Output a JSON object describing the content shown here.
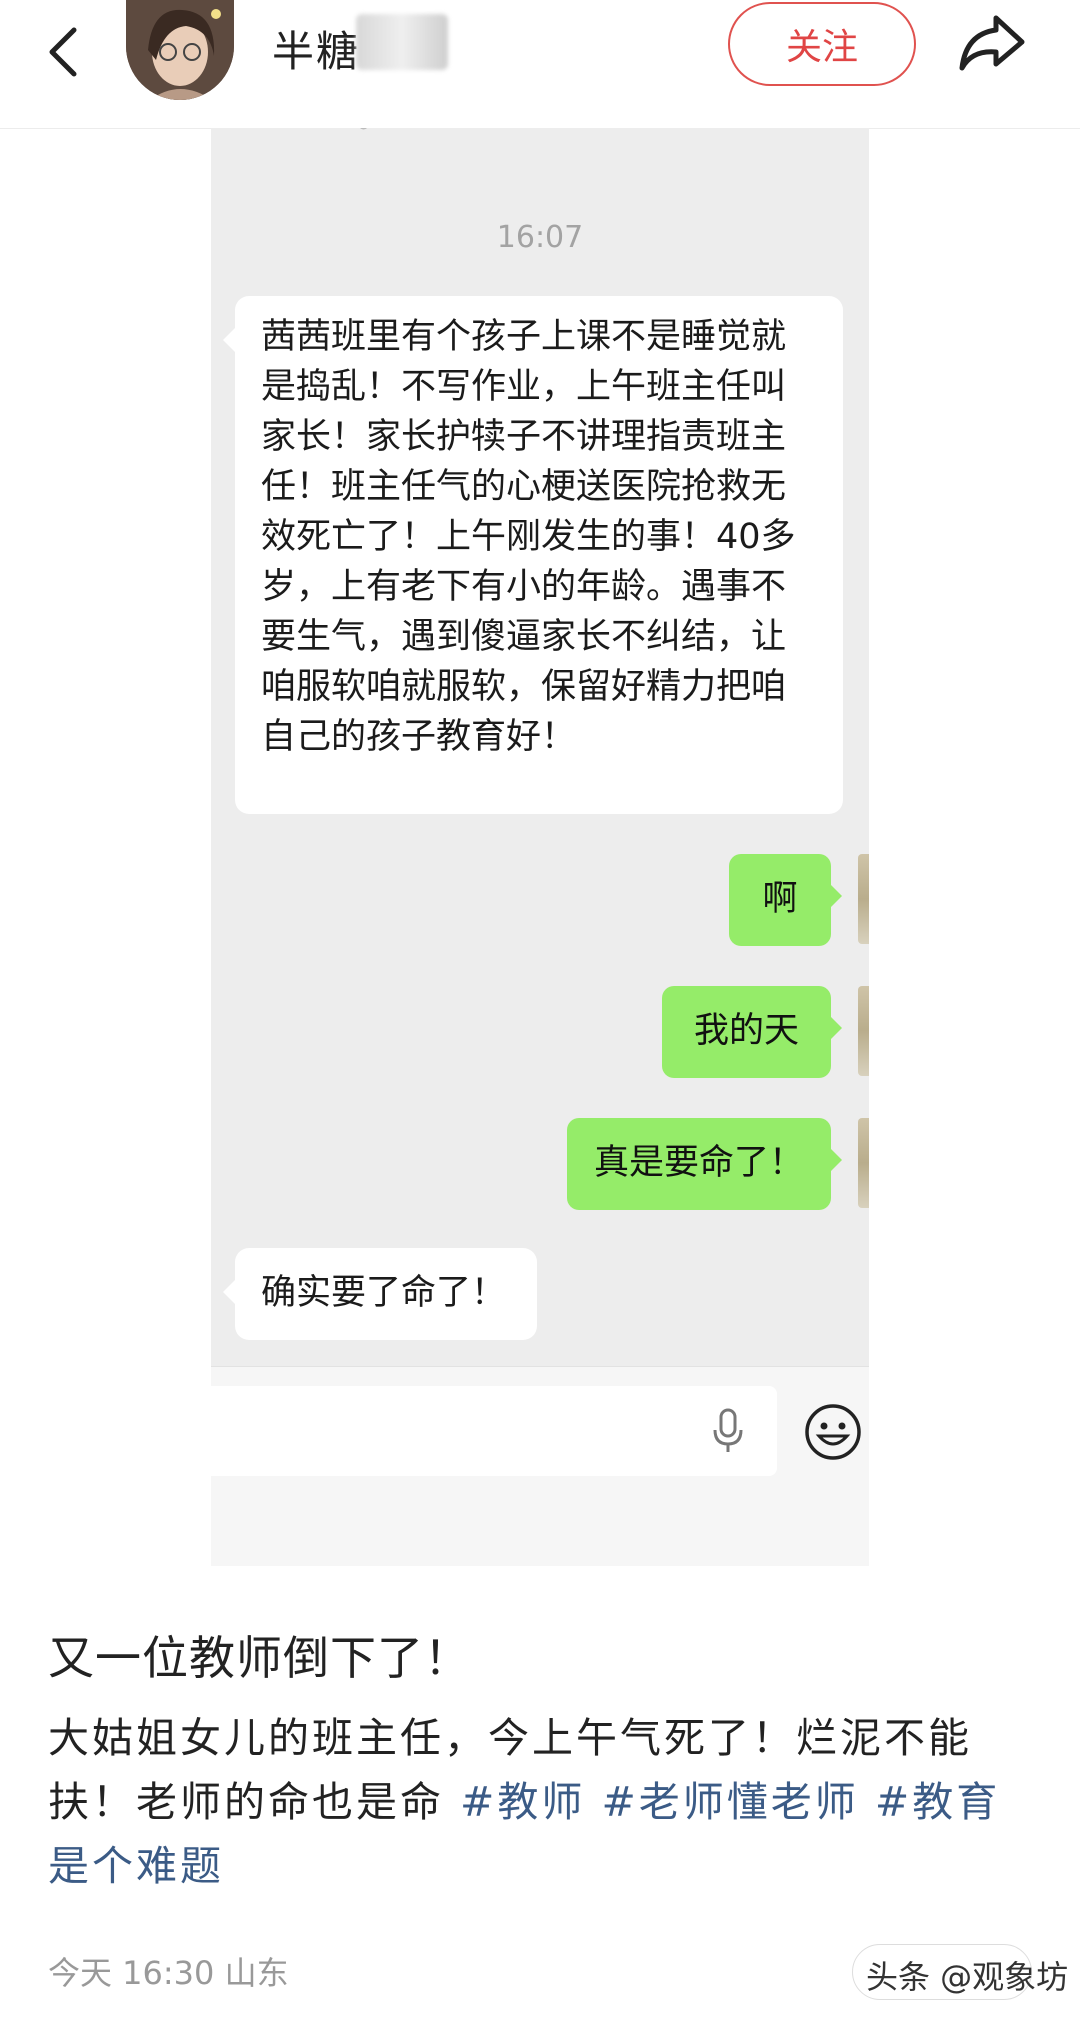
{
  "header": {
    "author_name": "半糖",
    "follow_label": "关注"
  },
  "chat": {
    "time": "16:07",
    "messages": [
      {
        "side": "left",
        "text": "茜茜班里有个孩子上课不是睡觉就是捣乱！不写作业，上午班主任叫家长！家长护犊子不讲理指责班主任！班主任气的心梗送医院抢救无效死亡了！上午刚发生的事！40多岁，上有老下有小的年龄。遇事不要生气，遇到傻逼家长不纠结，让咱服软咱就服软，保留好精力把咱自己的孩子教育好！"
      },
      {
        "side": "right",
        "text": "啊"
      },
      {
        "side": "right",
        "text": "我的天"
      },
      {
        "side": "right",
        "text": "真是要命了！"
      },
      {
        "side": "left",
        "text": "确实要了命了！"
      }
    ]
  },
  "post": {
    "title": "又一位教师倒下了！",
    "body_text": "大姑姐女儿的班主任，今上午气死了！烂泥不能扶！老师的命也是命 ",
    "tags": [
      "#教师",
      "#老师懂老师",
      "#教育是个难题"
    ],
    "meta": "今天 16:30 山东",
    "watermark": "头条 @观象坊"
  },
  "colors": {
    "follow_red": "#e04545",
    "wechat_green": "#95ec69",
    "tag_blue": "#3b5b86"
  },
  "icons": [
    "back-arrow-icon",
    "share-icon",
    "microphone-icon",
    "emoji-icon"
  ]
}
